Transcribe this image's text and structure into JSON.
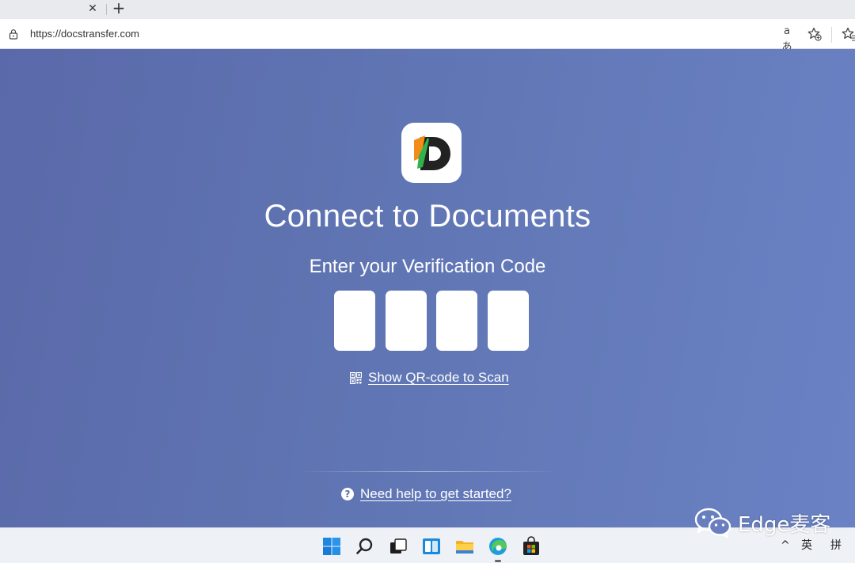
{
  "browser": {
    "tab_close_glyph": "✕",
    "new_tab_glyph": "+",
    "url": "https://docstransfer.com",
    "read_aloud_glyph": "aあ"
  },
  "main": {
    "title": "Connect to Documents",
    "subtitle": "Enter your Verification Code",
    "code_inputs": [
      "",
      "",
      "",
      ""
    ],
    "qr_link_label": "Show QR-code to Scan",
    "help_link_label": "Need help to get started?",
    "help_glyph": "?"
  },
  "taskbar": {
    "icons": [
      "windows-start-icon",
      "search-icon",
      "task-view-icon",
      "widgets-icon",
      "file-explorer-icon",
      "edge-browser-icon",
      "microsoft-store-icon"
    ],
    "tray_chevron": "^",
    "tray_lang": "英",
    "tray_ime": "拼"
  },
  "watermark": {
    "text": "Edge麦客"
  },
  "colors": {
    "page_bg": "#6075b3",
    "logo_orange": "#f28c1a",
    "logo_green": "#2fb34a",
    "logo_dark": "#222222"
  }
}
